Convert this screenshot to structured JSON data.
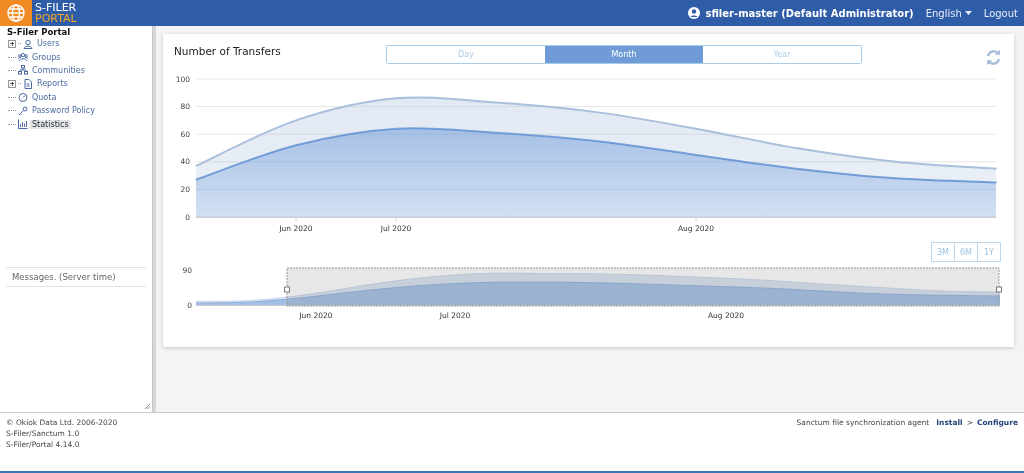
{
  "header": {
    "logo_top": "S-FILER",
    "logo_bottom": "PORTAL",
    "user": "sfiler-master (Default Administrator)",
    "language": "English",
    "logout": "Logout"
  },
  "sidebar": {
    "root": "S-Filer Portal",
    "items": [
      {
        "label": "Users",
        "kind": "collapsed",
        "selected": false
      },
      {
        "label": "Groups",
        "kind": "leaf",
        "selected": false
      },
      {
        "label": "Communities",
        "kind": "leaf",
        "selected": false
      },
      {
        "label": "Reports",
        "kind": "collapsed",
        "selected": false
      },
      {
        "label": "Quota",
        "kind": "leaf",
        "selected": false
      },
      {
        "label": "Password Policy",
        "kind": "leaf",
        "selected": false
      },
      {
        "label": "Statistics",
        "kind": "leaf",
        "selected": true
      }
    ],
    "messages_title": "Messages. (Server time)"
  },
  "card": {
    "title": "Number of Transfers",
    "periods": [
      {
        "label": "Day",
        "selected": false
      },
      {
        "label": "Month",
        "selected": true
      },
      {
        "label": "Year",
        "selected": false
      }
    ],
    "chart_data": {
      "type": "area",
      "stacked": true,
      "grid": true,
      "categories": [
        null,
        "Jun 2020",
        "Jul 2020",
        null,
        null,
        "Aug 2020",
        null,
        null,
        null
      ],
      "ylim": [
        0,
        100
      ],
      "yticks": [
        0,
        20,
        40,
        60,
        80,
        100
      ],
      "series": [
        {
          "color": "#6a97d6",
          "values": [
            27,
            52,
            64,
            61,
            55,
            45,
            35,
            28,
            25
          ]
        },
        {
          "color": "#a9bfdc",
          "values": [
            10,
            18,
            22,
            22,
            21,
            19,
            15,
            12,
            10
          ]
        }
      ]
    },
    "ranges": [
      {
        "label": "3M",
        "selected": false
      },
      {
        "label": "6M",
        "selected": false
      },
      {
        "label": "1Y",
        "selected": false
      }
    ],
    "navigator": {
      "y_labels": [
        "90",
        "0"
      ],
      "x_labels": [
        "Jun 2020",
        "Jul 2020",
        "Aug 2020"
      ]
    }
  },
  "footer": {
    "lines": [
      "© Okiok Data Ltd. 2006-2020",
      "S-Filer/Sanctum 1.0",
      "S-Filer/Portal 4.14.0"
    ],
    "agent": "Sanctum file synchronization agent",
    "install": "Install",
    "separator": ">",
    "configure": "Configure"
  }
}
